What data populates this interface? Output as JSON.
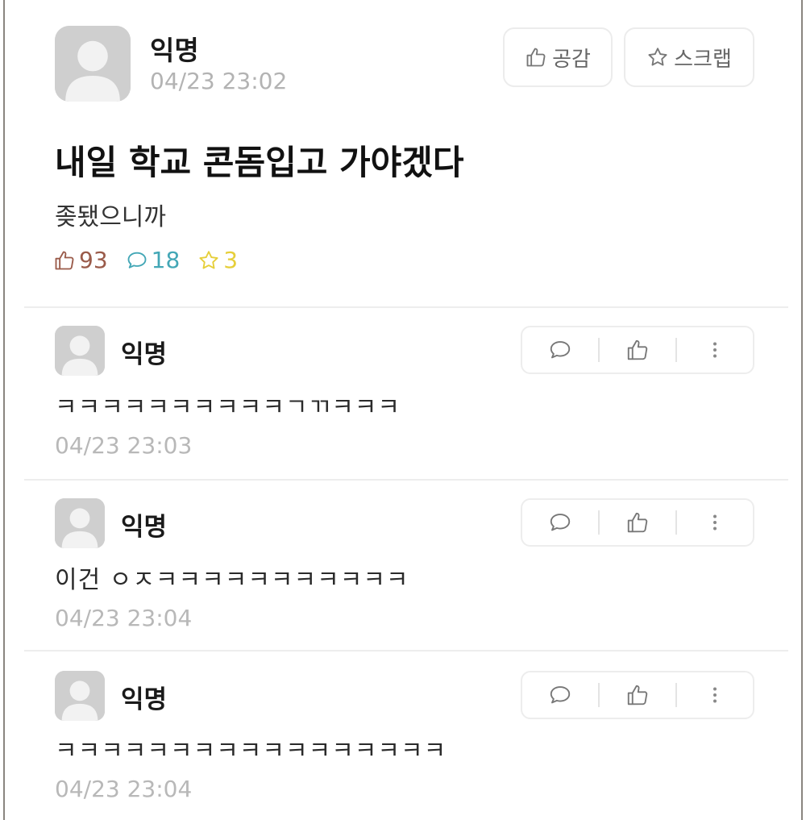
{
  "post": {
    "author": "익명",
    "time": "04/23 23:02",
    "like_button": "공감",
    "scrap_button": "스크랩",
    "title": "내일 학교 콘돔입고 가야겠다",
    "body": "좆됐으니까",
    "stats": {
      "likes": "93",
      "comments": "18",
      "scraps": "3"
    }
  },
  "comments": [
    {
      "author": "익명",
      "text": "ㅋㅋㅋㅋㅋㅋㅋㅋㅋㅋㄱㄲㅋㅋㅋ",
      "time": "04/23 23:03"
    },
    {
      "author": "익명",
      "text": "이건 ㅇㅈㅋㅋㅋㅋㅋㅋㅋㅋㅋㅋㅋ",
      "time": "04/23 23:04"
    },
    {
      "author": "익명",
      "text": "ㅋㅋㅋㅋㅋㅋㅋㅋㅋㅋㅋㅋㅋㅋㅋㅋㅋ",
      "time": "04/23 23:04"
    }
  ],
  "colors": {
    "like": "#9a5b4a",
    "comment": "#43a7b6",
    "scrap": "#e6cf3a"
  },
  "icons": [
    "avatar-icon",
    "thumbs-up-icon",
    "star-icon",
    "comment-icon",
    "more-vertical-icon"
  ]
}
